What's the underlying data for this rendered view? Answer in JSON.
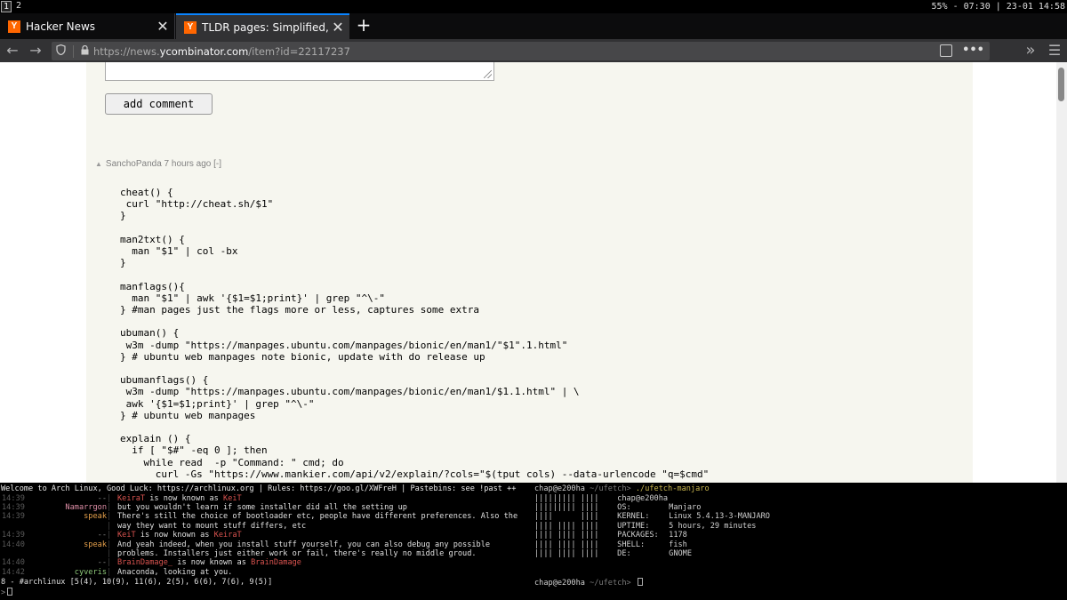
{
  "wm": {
    "workspaces": [
      "1",
      "2"
    ],
    "status": "55% - 07:30 | 23-01 14:58"
  },
  "browser": {
    "tabs": [
      {
        "favicon": "Y",
        "title": "Hacker News"
      },
      {
        "favicon": "Y",
        "title": "TLDR pages: Simplified, comm"
      }
    ],
    "new_tab": "+",
    "url_prefix": "https://news.",
    "url_domain": "ycombinator.com",
    "url_suffix": "/item?id=22117237",
    "more_menu": "•••",
    "overflow": "»",
    "menu": "☰"
  },
  "page": {
    "add_comment_label": "add comment",
    "comment": {
      "user": "SanchoPanda",
      "age": "7 hours ago",
      "toggle": "[-]",
      "code": "cheat() {\n curl \"http://cheat.sh/$1\"\n}\n\nman2txt() {\n  man \"$1\" | col -bx\n}\n\nmanflags(){\n  man \"$1\" | awk '{$1=$1;print}' | grep \"^\\-\"\n} #man pages just the flags more or less, captures some extra\n\nubuman() {\n w3m -dump \"https://manpages.ubuntu.com/manpages/bionic/en/man1/\"$1\".1.html\"\n} # ubuntu web manpages note bionic, update with do release up\n\nubumanflags() {\n w3m -dump \"https://manpages.ubuntu.com/manpages/bionic/en/man1/$1.1.html\" | \\\n awk '{$1=$1;print}' | grep \"^\\-\"\n} # ubuntu web manpages\n\nexplain () {\n  if [ \"$#\" -eq 0 ]; then\n    while read  -p \"Command: \" cmd; do\n      curl -Gs \"https://www.mankier.com/api/v2/explain/?cols=\"$(tput cols) --data-urlencode \"q=$cmd\""
    }
  },
  "irc": {
    "topic": "Welcome to Arch Linux, Good Luck: https://archlinux.org | Rules: https://goo.gl/XWFreH | Pastebins: see !past ++",
    "lines": [
      {
        "ts": "14:39",
        "nick": "--",
        "msg_pre": "",
        "hl1": "KeiraT",
        "mid": " is now known as ",
        "hl2": "KeiT",
        "kind": "nick"
      },
      {
        "ts": "14:39",
        "nick": "Namarrgon",
        "msg": "but you wouldn't learn if some installer did all the setting up",
        "kind": "msg",
        "nickcolor": "k-pink"
      },
      {
        "ts": "14:39",
        "nick": "speak",
        "msg": "There's still the choice of bootloader etc, people have different preferences. Also the",
        "kind": "msg",
        "nickcolor": "k-orange"
      },
      {
        "ts": "",
        "nick": "",
        "msg": "way they want to mount stuff differs, etc",
        "kind": "cont"
      },
      {
        "ts": "14:39",
        "nick": "--",
        "msg_pre": "",
        "hl1": "KeiT",
        "mid": " is now known as ",
        "hl2": "KeiraT",
        "kind": "nick"
      },
      {
        "ts": "14:40",
        "nick": "speak",
        "msg": "And yeah indeed, when you install stuff yourself, you can also debug any possible",
        "kind": "msg",
        "nickcolor": "k-orange"
      },
      {
        "ts": "",
        "nick": "",
        "msg": "problems. Installers just either work or fail, there's really no middle groud.",
        "kind": "cont"
      },
      {
        "ts": "14:40",
        "nick": "--",
        "msg_pre": "",
        "hl1": "BrainDamage_",
        "mid": " is now known as ",
        "hl2": "BrainDamage",
        "kind": "nick"
      },
      {
        "ts": "14:42",
        "nick": "cyveris",
        "msg": "Anaconda, looking at you.",
        "kind": "msg",
        "nickcolor": "k-green"
      }
    ],
    "status": "8 - #archlinux [5(4), 10(9), 11(6), 2(5), 6(6), 7(6), 9(5)]",
    "prompt": ">"
  },
  "ufetch": {
    "prompt_user": "chap@e200ha",
    "prompt_path": " ~/ufetch> ",
    "command": "./ufetch-manjaro",
    "host": "chap@e200ha",
    "info": [
      {
        "key": "OS:",
        "value": "Manjaro"
      },
      {
        "key": "KERNEL:",
        "value": "Linux 5.4.13-3-MANJARO"
      },
      {
        "key": "UPTIME:",
        "value": "5 hours, 29 minutes"
      },
      {
        "key": "PACKAGES:",
        "value": "1178"
      },
      {
        "key": "SHELL:",
        "value": "fish"
      },
      {
        "key": "DE:",
        "value": "GNOME"
      }
    ],
    "logo": [
      "||||||||| ||||  ",
      "||||||||| ||||  ",
      "||||      ||||  ",
      "|||| |||| ||||  ",
      "|||| |||| ||||  ",
      "|||| |||| ||||  ",
      "|||| |||| ||||  "
    ],
    "final_prompt_user": "chap@e200ha",
    "final_prompt_path": " ~/ufetch> "
  },
  "colors": {
    "hn_bg": "#f6f6ef",
    "hn_orange": "#ff6600",
    "firefox_tab_active": "#323234",
    "firefox_accent": "#0a84ff"
  }
}
